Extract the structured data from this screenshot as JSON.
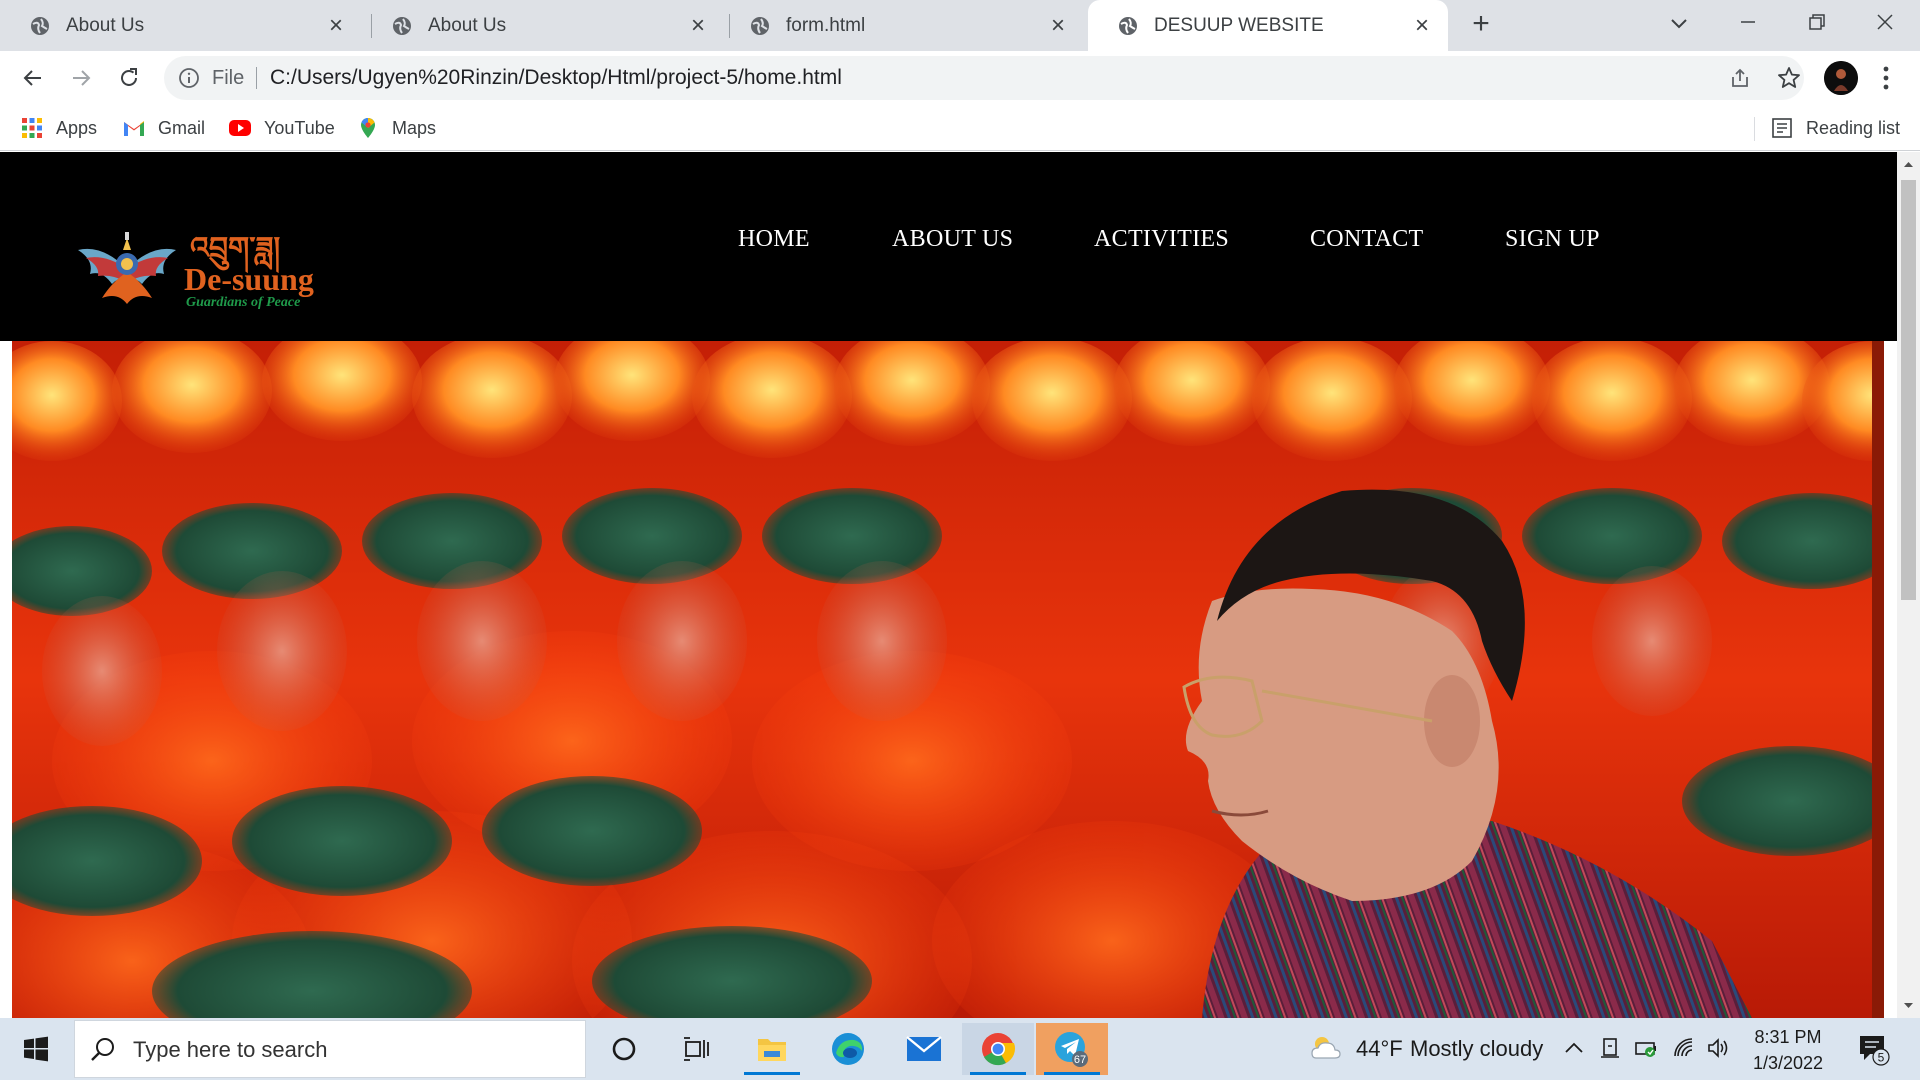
{
  "browser": {
    "tabs": [
      {
        "title": "About Us",
        "active": false
      },
      {
        "title": "About Us",
        "active": false
      },
      {
        "title": "form.html",
        "active": false
      },
      {
        "title": "DESUUP WEBSITE",
        "active": true
      }
    ],
    "address_bar": {
      "scheme_label": "File",
      "url": "C:/Users/Ugyen%20Rinzin/Desktop/Html/project-5/home.html"
    },
    "bookmarks": [
      {
        "label": "Apps",
        "icon": "apps-grid-icon"
      },
      {
        "label": "Gmail",
        "icon": "gmail-icon"
      },
      {
        "label": "YouTube",
        "icon": "youtube-icon"
      },
      {
        "label": "Maps",
        "icon": "maps-icon"
      }
    ],
    "reading_list_label": "Reading list"
  },
  "page": {
    "logo": {
      "script_text": "འབྲུག་ཟླ།",
      "brand_text": "De-suung",
      "tagline": "Guardians of Peace"
    },
    "nav": [
      {
        "label": "HOME"
      },
      {
        "label": "ABOUT US"
      },
      {
        "label": "ACTIVITIES"
      },
      {
        "label": "CONTACT"
      },
      {
        "label": "SIGN UP"
      }
    ],
    "colors": {
      "header_bg": "#000000",
      "logo_orange": "#e0621f",
      "logo_green": "#1f9a4a",
      "hero_orange": "#ff4a12",
      "hero_beret": "#1e4a36"
    }
  },
  "taskbar": {
    "search_placeholder": "Type here to search",
    "weather": {
      "temperature": "44°F",
      "condition": "Mostly cloudy"
    },
    "time": "8:31 PM",
    "date": "1/3/2022",
    "telegram_badge": "67",
    "notification_count": "5"
  }
}
